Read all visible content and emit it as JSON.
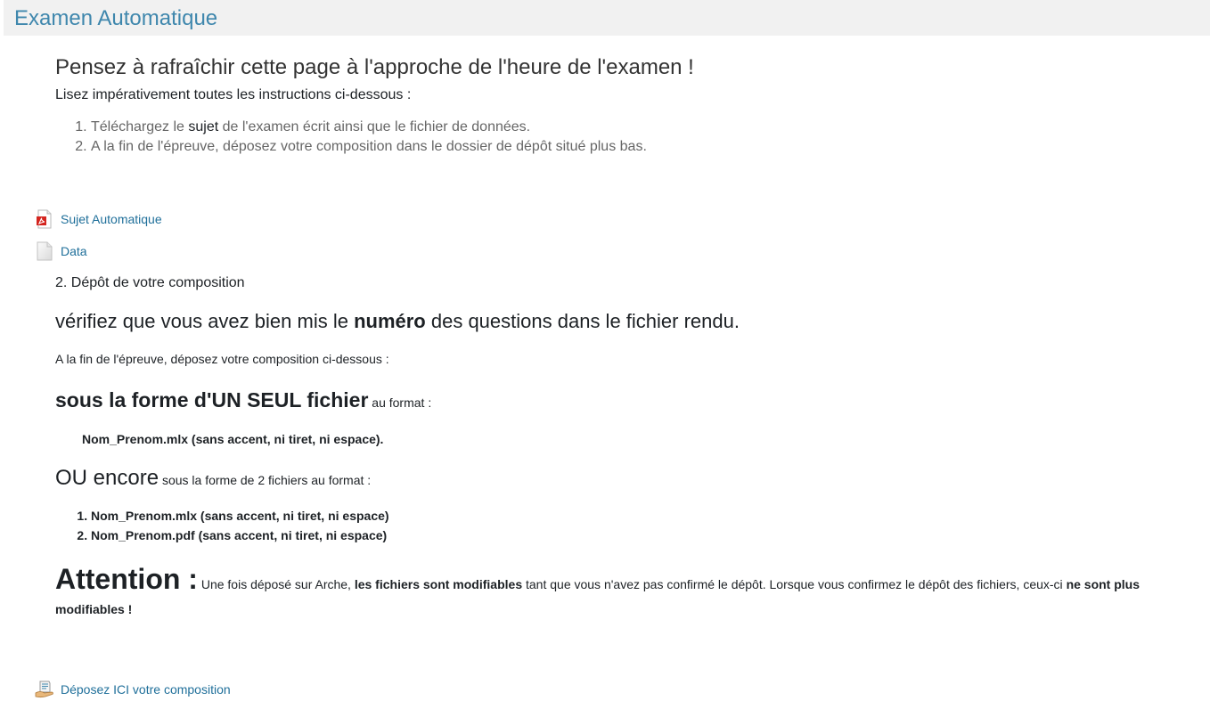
{
  "section": {
    "title": "Examen Automatique"
  },
  "summary": {
    "refresh_heading": "Pensez à rafraîchir cette page à l'approche de l'heure de l'examen !",
    "instructions_intro": "Lisez impérativement toutes les instructions ci-dessous :",
    "step1_before": "Téléchargez le ",
    "step1_bold": "sujet",
    "step1_after": " de l'examen écrit ainsi que le fichier de données.",
    "step2": "A la fin de l'épreuve, déposez votre composition dans le dossier de dépôt situé plus bas."
  },
  "activities": {
    "sujet": {
      "label": "Sujet Automatique",
      "icon": "pdf-file-icon"
    },
    "data": {
      "label": "Data",
      "icon": "generic-file-icon"
    },
    "depot": {
      "label": "Déposez ICI votre composition",
      "icon": "assignment-upload-icon"
    }
  },
  "depot_label": {
    "heading": "2. Dépôt de votre composition",
    "verify_before": "vérifiez que vous avez bien mis le ",
    "verify_bold": "numéro",
    "verify_after": " des questions dans le fichier rendu.",
    "end_text": "A la fin de l'épreuve, déposez votre composition ci-dessous :",
    "single_file_bold": "sous la forme d'UN SEUL fichier",
    "single_file_after": " au format :",
    "single_file_format": "Nom_Prenom.mlx  (sans accent, ni tiret, ni espace).",
    "ou_encore": "OU encore",
    "two_files_text": " sous la forme de 2 fichiers au format :",
    "two_files": [
      "Nom_Prenom.mlx  (sans accent, ni tiret, ni espace)",
      "Nom_Prenom.pdf  (sans accent, ni tiret, ni espace)"
    ],
    "attention": "Attention :",
    "attention_part1": " Une fois déposé sur Arche, ",
    "attention_bold1": "les fichiers sont modifiables",
    "attention_part2": " tant que vous n'avez pas confirmé le dépôt. Lorsque vous confirmez le dépôt des fichiers, ceux-ci ",
    "attention_bold2": "ne sont plus modifiables !"
  },
  "colors": {
    "link": "#1f6f9a",
    "section_title": "#3f87ad",
    "header_bg": "#f1f1f1"
  }
}
